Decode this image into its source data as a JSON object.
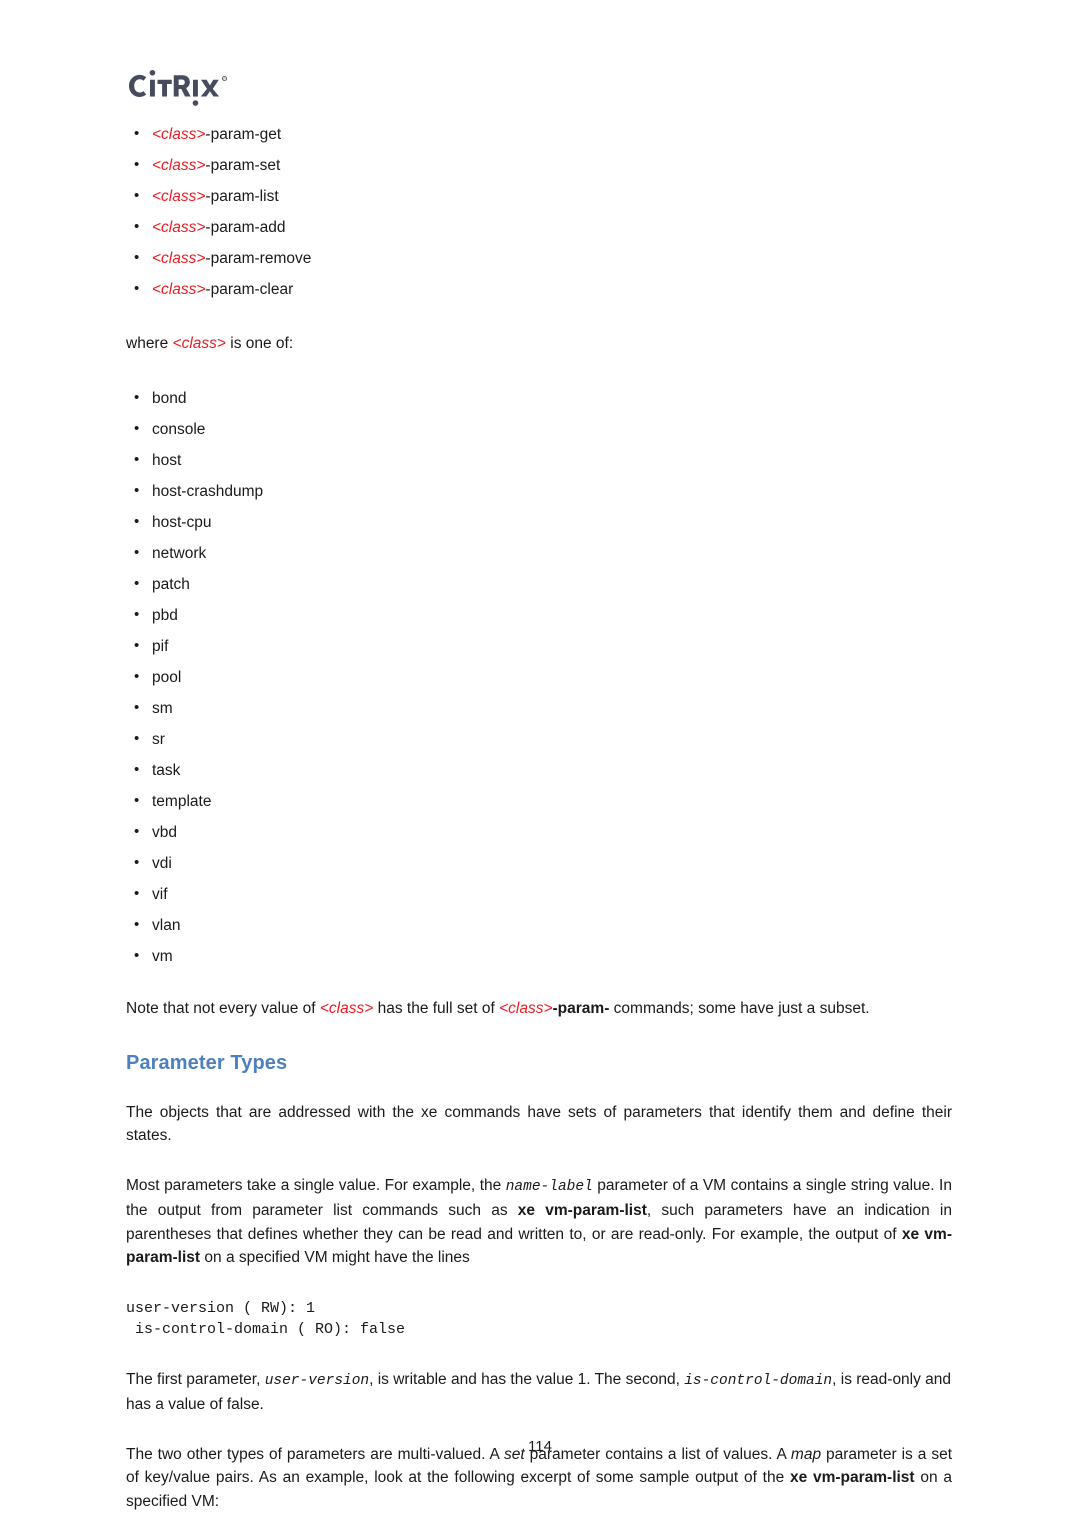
{
  "logo": {
    "name": "citrix-logo",
    "text": "CITRIX",
    "trademark": "®",
    "color": "#474b5e"
  },
  "colors": {
    "class_red": "#ee1c24",
    "heading_blue": "#4e80bd",
    "body_black": "#1a1a1a",
    "page_background": "#ffffff"
  },
  "param_commands": {
    "items": [
      {
        "class_token": "<class>",
        "suffix": "-param-get"
      },
      {
        "class_token": "<class>",
        "suffix": "-param-set"
      },
      {
        "class_token": "<class>",
        "suffix": "-param-list"
      },
      {
        "class_token": "<class>",
        "suffix": "-param-add"
      },
      {
        "class_token": "<class>",
        "suffix": "-param-remove"
      },
      {
        "class_token": "<class>",
        "suffix": "-param-clear"
      }
    ]
  },
  "where_line": {
    "prefix": "where ",
    "class_token": "<class>",
    "suffix": " is one of:"
  },
  "class_values": {
    "items": [
      "bond",
      "console",
      "host",
      "host-crashdump",
      "host-cpu",
      "network",
      "patch",
      "pbd",
      "pif",
      "pool",
      "sm",
      "sr",
      "task",
      "template",
      "vbd",
      "vdi",
      "vif",
      "vlan",
      "vm"
    ]
  },
  "note_paragraph": {
    "part1": "Note that not every value of ",
    "class1": "<class>",
    "part2": " has the full set of ",
    "class2": "<class>",
    "bold_param": "-param-",
    "part3": " commands; some have just a subset."
  },
  "heading": {
    "text": "Parameter Types"
  },
  "paragraph_1": {
    "text": "The objects that are addressed with the xe commands have sets of parameters that identify them and define their states."
  },
  "paragraph_2": {
    "part1": "Most parameters take a single value. For example, the ",
    "code1": "name-label",
    "part2": " parameter of a VM contains a single string value. In the output from parameter list commands such as ",
    "bold1": "xe vm-param-list",
    "part3": ", such parameters have an indication in parentheses that defines whether they can be read and written to, or are read-only. For example, the output of ",
    "bold2": "xe vm-param-list",
    "part4": " on a specified VM might have the lines"
  },
  "code_block": {
    "line1": "user-version ( RW): 1",
    "line2": " is-control-domain ( RO): false"
  },
  "paragraph_3": {
    "part1": "The first parameter, ",
    "code1": "user-version",
    "part2": ", is writable and has the value 1. The second, ",
    "code2": "is-control-domain",
    "part3": ", is read-only and has a value of false."
  },
  "paragraph_4": {
    "part1": "The two other types of parameters are multi-valued. A ",
    "italic1": "set",
    "part2": " parameter contains a list of values. A ",
    "italic2": "map",
    "part3": " parameter is a set of key/value pairs. As an example, look at the following excerpt of some sample output of the ",
    "bold1": "xe vm-param-list",
    "part4": " on a specified VM:"
  },
  "footer": {
    "page_number": "114"
  }
}
